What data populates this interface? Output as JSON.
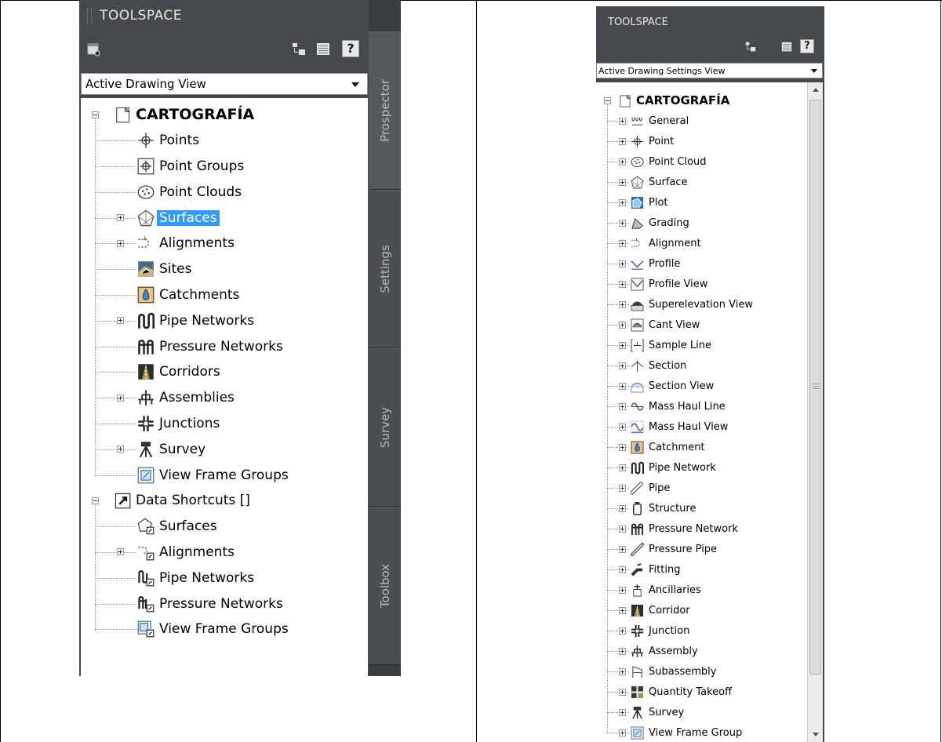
{
  "left_panel": {
    "title": "TOOLSPACE",
    "dropdown_value": "Active Drawing View",
    "help_label": "?",
    "tabs": [
      "Prospector",
      "Settings",
      "Survey",
      "Toolbox"
    ],
    "tree": [
      {
        "label": "CARTOGRAFÍA",
        "icon": "drawing-icon",
        "level": 0,
        "expander": "minus",
        "bold": true
      },
      {
        "label": "Points",
        "icon": "point-icon",
        "level": 1,
        "expander": "none"
      },
      {
        "label": "Point Groups",
        "icon": "point-group-icon",
        "level": 1,
        "expander": "none"
      },
      {
        "label": "Point Clouds",
        "icon": "point-cloud-icon",
        "level": 1,
        "expander": "none"
      },
      {
        "label": "Surfaces",
        "icon": "surface-icon",
        "level": 1,
        "expander": "plus",
        "selected": true
      },
      {
        "label": "Alignments",
        "icon": "alignment-icon",
        "level": 1,
        "expander": "plus"
      },
      {
        "label": "Sites",
        "icon": "site-icon",
        "level": 1,
        "expander": "none"
      },
      {
        "label": "Catchments",
        "icon": "catchment-icon",
        "level": 1,
        "expander": "none"
      },
      {
        "label": "Pipe Networks",
        "icon": "pipe-network-icon",
        "level": 1,
        "expander": "plus"
      },
      {
        "label": "Pressure Networks",
        "icon": "pressure-network-icon",
        "level": 1,
        "expander": "none"
      },
      {
        "label": "Corridors",
        "icon": "corridor-icon",
        "level": 1,
        "expander": "none"
      },
      {
        "label": "Assemblies",
        "icon": "assembly-icon",
        "level": 1,
        "expander": "plus"
      },
      {
        "label": "Junctions",
        "icon": "junction-icon",
        "level": 1,
        "expander": "none"
      },
      {
        "label": "Survey",
        "icon": "survey-icon",
        "level": 1,
        "expander": "plus"
      },
      {
        "label": "View Frame Groups",
        "icon": "view-frame-group-icon",
        "level": 1,
        "expander": "none"
      },
      {
        "label": "Data Shortcuts []",
        "icon": "data-shortcut-icon",
        "level": 0,
        "expander": "minus"
      },
      {
        "label": "Surfaces",
        "icon": "surface-shortcut-icon",
        "level": 1,
        "expander": "none"
      },
      {
        "label": "Alignments",
        "icon": "alignment-shortcut-icon",
        "level": 1,
        "expander": "plus"
      },
      {
        "label": "Pipe Networks",
        "icon": "pipe-network-shortcut-icon",
        "level": 1,
        "expander": "none"
      },
      {
        "label": "Pressure Networks",
        "icon": "pressure-network-shortcut-icon",
        "level": 1,
        "expander": "none"
      },
      {
        "label": "View Frame Groups",
        "icon": "view-frame-group-shortcut-icon",
        "level": 1,
        "expander": "none"
      }
    ]
  },
  "right_panel": {
    "title": "TOOLSPACE",
    "dropdown_value": "Active Drawing Settings View",
    "help_label": "?",
    "tree": [
      {
        "label": "CARTOGRAFÍA",
        "icon": "drawing-icon",
        "level": 0,
        "expander": "minus",
        "bold": true
      },
      {
        "label": "General",
        "icon": "general-icon",
        "level": 1,
        "expander": "plus"
      },
      {
        "label": "Point",
        "icon": "point-icon",
        "level": 1,
        "expander": "plus"
      },
      {
        "label": "Point Cloud",
        "icon": "point-cloud-icon",
        "level": 1,
        "expander": "plus"
      },
      {
        "label": "Surface",
        "icon": "surface-icon",
        "level": 1,
        "expander": "plus"
      },
      {
        "label": "Plot",
        "icon": "plot-icon",
        "level": 1,
        "expander": "plus"
      },
      {
        "label": "Grading",
        "icon": "grading-icon",
        "level": 1,
        "expander": "plus"
      },
      {
        "label": "Alignment",
        "icon": "alignment-icon",
        "level": 1,
        "expander": "plus"
      },
      {
        "label": "Profile",
        "icon": "profile-icon",
        "level": 1,
        "expander": "plus"
      },
      {
        "label": "Profile View",
        "icon": "profile-view-icon",
        "level": 1,
        "expander": "plus"
      },
      {
        "label": "Superelevation View",
        "icon": "superelevation-view-icon",
        "level": 1,
        "expander": "plus"
      },
      {
        "label": "Cant View",
        "icon": "cant-view-icon",
        "level": 1,
        "expander": "plus"
      },
      {
        "label": "Sample Line",
        "icon": "sample-line-icon",
        "level": 1,
        "expander": "plus"
      },
      {
        "label": "Section",
        "icon": "section-icon",
        "level": 1,
        "expander": "plus"
      },
      {
        "label": "Section View",
        "icon": "section-view-icon",
        "level": 1,
        "expander": "plus"
      },
      {
        "label": "Mass Haul Line",
        "icon": "mass-haul-line-icon",
        "level": 1,
        "expander": "plus"
      },
      {
        "label": "Mass Haul View",
        "icon": "mass-haul-view-icon",
        "level": 1,
        "expander": "plus"
      },
      {
        "label": "Catchment",
        "icon": "catchment-icon",
        "level": 1,
        "expander": "plus"
      },
      {
        "label": "Pipe Network",
        "icon": "pipe-network-icon",
        "level": 1,
        "expander": "plus"
      },
      {
        "label": "Pipe",
        "icon": "pipe-icon",
        "level": 1,
        "expander": "plus"
      },
      {
        "label": "Structure",
        "icon": "structure-icon",
        "level": 1,
        "expander": "plus"
      },
      {
        "label": "Pressure Network",
        "icon": "pressure-network-icon",
        "level": 1,
        "expander": "plus"
      },
      {
        "label": "Pressure Pipe",
        "icon": "pressure-pipe-icon",
        "level": 1,
        "expander": "plus"
      },
      {
        "label": "Fitting",
        "icon": "fitting-icon",
        "level": 1,
        "expander": "plus"
      },
      {
        "label": "Ancillaries",
        "icon": "ancillaries-icon",
        "level": 1,
        "expander": "plus"
      },
      {
        "label": "Corridor",
        "icon": "corridor-icon",
        "level": 1,
        "expander": "plus"
      },
      {
        "label": "Junction",
        "icon": "junction-icon",
        "level": 1,
        "expander": "plus"
      },
      {
        "label": "Assembly",
        "icon": "assembly-icon",
        "level": 1,
        "expander": "plus"
      },
      {
        "label": "Subassembly",
        "icon": "subassembly-icon",
        "level": 1,
        "expander": "plus"
      },
      {
        "label": "Quantity Takeoff",
        "icon": "quantity-takeoff-icon",
        "level": 1,
        "expander": "plus"
      },
      {
        "label": "Survey",
        "icon": "survey-icon",
        "level": 1,
        "expander": "plus"
      },
      {
        "label": "View Frame Group",
        "icon": "view-frame-group-icon",
        "level": 1,
        "expander": "plus"
      }
    ]
  },
  "colors": {
    "panel_bg": "#45494d",
    "selection": "#3399ff",
    "tab_text": "#b8b8b8"
  }
}
